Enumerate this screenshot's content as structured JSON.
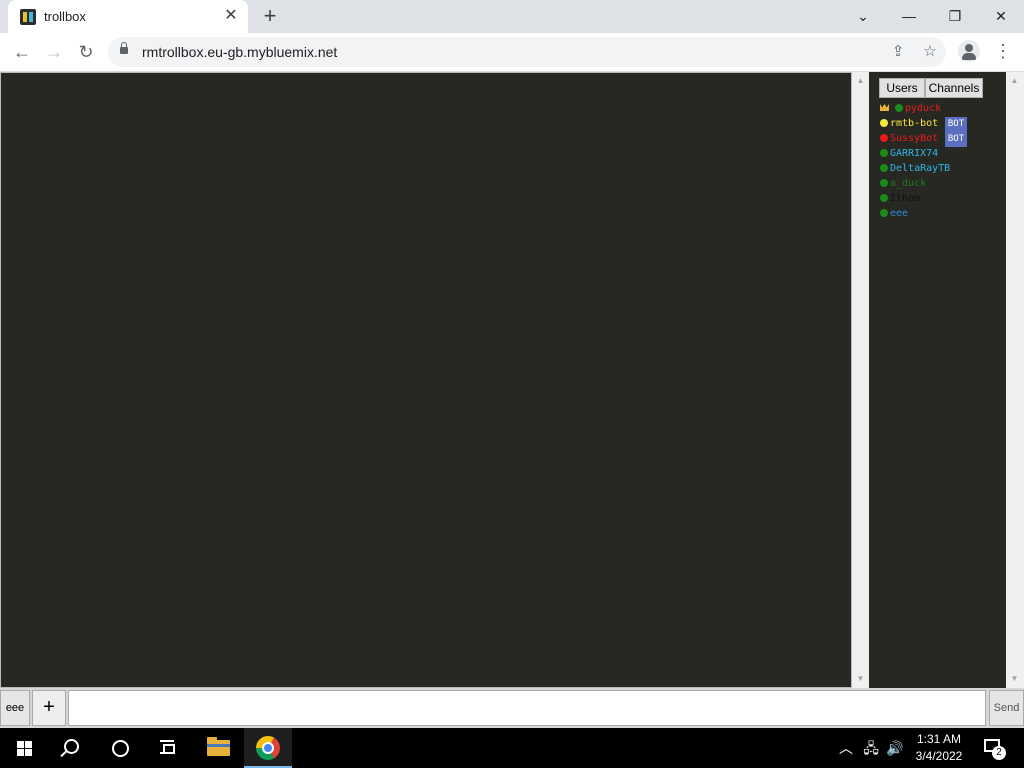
{
  "browser": {
    "tab": {
      "title": "trollbox",
      "close_glyph": "✕"
    },
    "new_tab_glyph": "+",
    "window_controls": {
      "tab_search": "⌄",
      "minimize": "—",
      "restore": "❐",
      "close": "✕"
    },
    "nav": {
      "back": "←",
      "forward": "→",
      "reload": "↻"
    },
    "url": "rmtrollbox.eu-gb.mybluemix.net",
    "omnibox_icons": {
      "share": "⇪",
      "bookmark": "☆"
    },
    "menu_glyph": "⋮"
  },
  "sidebar": {
    "tabs": [
      {
        "label": "Users"
      },
      {
        "label": "Channels"
      }
    ],
    "users": [
      {
        "name": "pyduck",
        "color": "#e81a1a",
        "dot": "#1a8a1a",
        "crown": true,
        "bot": false
      },
      {
        "name": "rmtb-bot",
        "color": "#f5e642",
        "dot": "#f5e642",
        "crown": false,
        "bot": true
      },
      {
        "name": "SussyBot",
        "color": "#e81a1a",
        "dot": "#e81a1a",
        "crown": false,
        "bot": true
      },
      {
        "name": "GARRIX74",
        "color": "#2fb5e8",
        "dot": "#1a8a1a",
        "crown": false,
        "bot": false
      },
      {
        "name": "DeltaRayTB",
        "color": "#2fb5e8",
        "dot": "#1a8a1a",
        "crown": false,
        "bot": false
      },
      {
        "name": "a_duck",
        "color": "#1d7a1d",
        "dot": "#1a8a1a",
        "crown": false,
        "bot": false
      },
      {
        "name": "Ilham",
        "color": "#111111",
        "dot": "#1a8a1a",
        "crown": false,
        "bot": false
      },
      {
        "name": "eee",
        "color": "#2a8ad8",
        "dot": "#1a8a1a",
        "crown": false,
        "bot": false
      }
    ],
    "bot_badge": "BOT"
  },
  "scrollbar": {
    "up": "▲",
    "down": "▼"
  },
  "input_bar": {
    "nick": "eee",
    "plus": "+",
    "message_value": "",
    "send": "Send"
  },
  "taskbar": {
    "tray": {
      "chevron": "︿",
      "network": "🖧",
      "volume": "🔊"
    },
    "time": "1:31 AM",
    "date": "3/4/2022",
    "notification_count": "2"
  },
  "colors": {
    "page_bg": "#282823",
    "bot_badge_bg": "#5b6ec2",
    "accent_taskbar": "#76b9ed"
  }
}
